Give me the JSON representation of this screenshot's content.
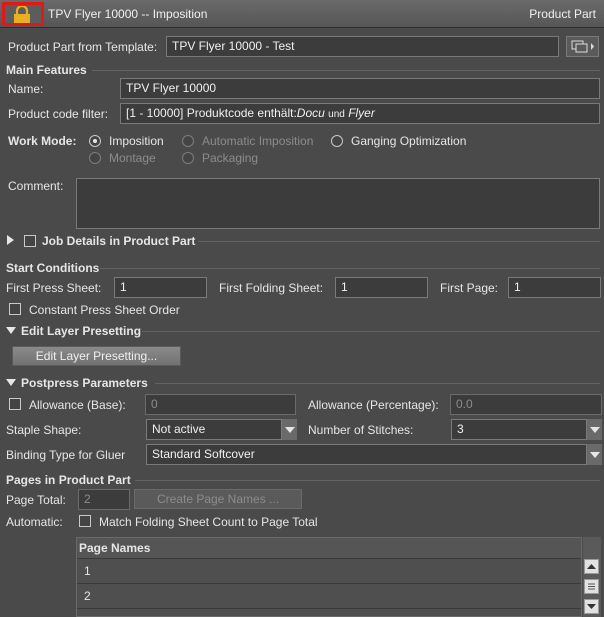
{
  "titlebar": {
    "title": "TPV Flyer 10000 -- Imposition",
    "right": "Product Part"
  },
  "template": {
    "label": "Product Part from Template:",
    "value": "TPV Flyer 10000 - Test"
  },
  "main_features": {
    "heading": "Main Features",
    "name_label": "Name:",
    "name_value": "TPV Flyer 10000",
    "filter_label": "Product code filter:",
    "filter_prefix": "[1 - 10000] Produktcode enthält:",
    "filter_term1": "Docu",
    "filter_and": "und",
    "filter_term2": "Flyer",
    "work_mode_label": "Work Mode:",
    "modes": {
      "imposition": "Imposition",
      "automatic": "Automatic Imposition",
      "ganging": "Ganging Optimization",
      "montage": "Montage",
      "packaging": "Packaging"
    },
    "selected_mode": "Imposition",
    "comment_label": "Comment:",
    "comment_value": ""
  },
  "job_details": {
    "label": "Job Details in Product Part"
  },
  "start_conditions": {
    "heading": "Start Conditions",
    "first_press_label": "First Press Sheet:",
    "first_press_value": "1",
    "first_folding_label": "First Folding Sheet:",
    "first_folding_value": "1",
    "first_page_label": "First Page:",
    "first_page_value": "1",
    "constant_order_label": "Constant Press Sheet Order"
  },
  "layer": {
    "heading": "Edit Layer Presetting",
    "button": "Edit Layer Presetting..."
  },
  "postpress": {
    "heading": "Postpress Parameters",
    "allowance_base_label": "Allowance (Base):",
    "allowance_base_value": "0",
    "allowance_pct_label": "Allowance (Percentage):",
    "allowance_pct_value": "0.0",
    "staple_label": "Staple Shape:",
    "staple_value": "Not active",
    "stitches_label": "Number of Stitches:",
    "stitches_value": "3",
    "binding_label": "Binding Type for Gluer",
    "binding_value": "Standard Softcover"
  },
  "pages": {
    "heading": "Pages in Product Part",
    "total_label": "Page Total:",
    "total_value": "2",
    "create_button": "Create Page Names ...",
    "automatic_label": "Automatic:",
    "match_label": "Match Folding Sheet Count to Page Total",
    "table_header": "Page Names",
    "rows": [
      "1",
      "2",
      ""
    ]
  },
  "colors": {
    "background": "#4a4a4a",
    "lock_highlight": "#e01818",
    "lock_icon": "#e8b020"
  }
}
